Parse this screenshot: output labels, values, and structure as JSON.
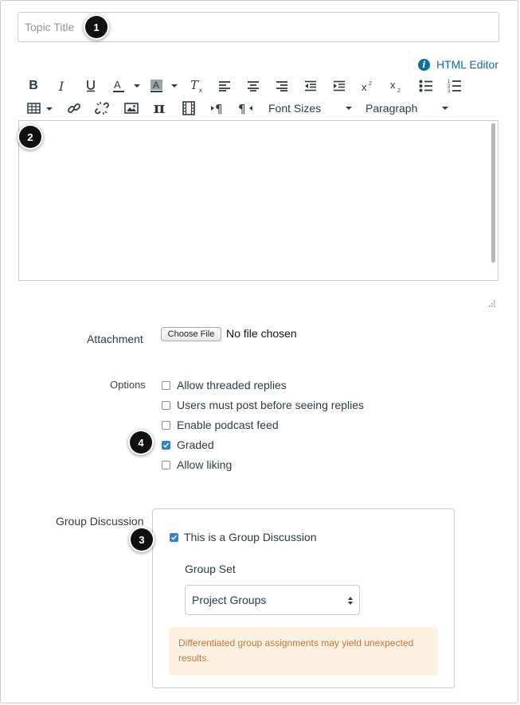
{
  "topic_title": {
    "placeholder": "Topic Title",
    "value": ""
  },
  "html_editor_link": "HTML Editor",
  "toolbar": {
    "font_sizes": "Font Sizes",
    "paragraph": "Paragraph",
    "icons": [
      "bold-icon",
      "italic-icon",
      "underline-icon",
      "text-color-icon",
      "background-color-icon",
      "clear-formatting-icon",
      "align-left-icon",
      "align-center-icon",
      "align-right-icon",
      "outdent-icon",
      "indent-icon",
      "superscript-icon",
      "subscript-icon",
      "bullet-list-icon",
      "numbered-list-icon",
      "table-icon",
      "link-icon",
      "unlink-icon",
      "image-icon",
      "math-equation-icon",
      "media-icon",
      "ltr-paragraph-icon",
      "rtl-paragraph-icon"
    ]
  },
  "attachment": {
    "label": "Attachment",
    "button_label": "Choose File",
    "status": "No file chosen"
  },
  "options": {
    "label": "Options",
    "items": [
      {
        "label": "Allow threaded replies",
        "checked": false
      },
      {
        "label": "Users must post before seeing replies",
        "checked": false
      },
      {
        "label": "Enable podcast feed",
        "checked": false
      },
      {
        "label": "Graded",
        "checked": true
      },
      {
        "label": "Allow liking",
        "checked": false
      }
    ]
  },
  "group_discussion": {
    "label": "Group Discussion",
    "checkbox_label": "This is a Group Discussion",
    "checked": true,
    "group_set_label": "Group Set",
    "group_set_value": "Project Groups",
    "warning": "Differentiated group assignments may yield unexpected results."
  },
  "markers": [
    "1",
    "2",
    "3",
    "4"
  ],
  "colors": {
    "link": "#0770a3",
    "checkbox": "#2f7fdc",
    "warning_bg": "#fdf2e2",
    "warning_text": "#c0763a"
  }
}
